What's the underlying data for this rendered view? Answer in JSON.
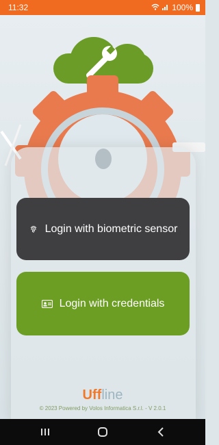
{
  "status_bar": {
    "time": "11:32",
    "battery": "100%"
  },
  "buttons": {
    "biometric_label": "Login with biometric sensor",
    "credentials_label": "Login with credentials"
  },
  "branding": {
    "logo_main": "Uff",
    "logo_rest": "line"
  },
  "footer": {
    "text": "© 2023 Powered by Volos Informatica S.r.l. - V 2.0.1"
  },
  "colors": {
    "status_bar": "#f06a1f",
    "biometric_button": "#3f3f41",
    "credentials_button": "#6b9e22"
  },
  "icons": {
    "biometric": "fingerprint-icon",
    "credentials": "id-card-icon"
  }
}
